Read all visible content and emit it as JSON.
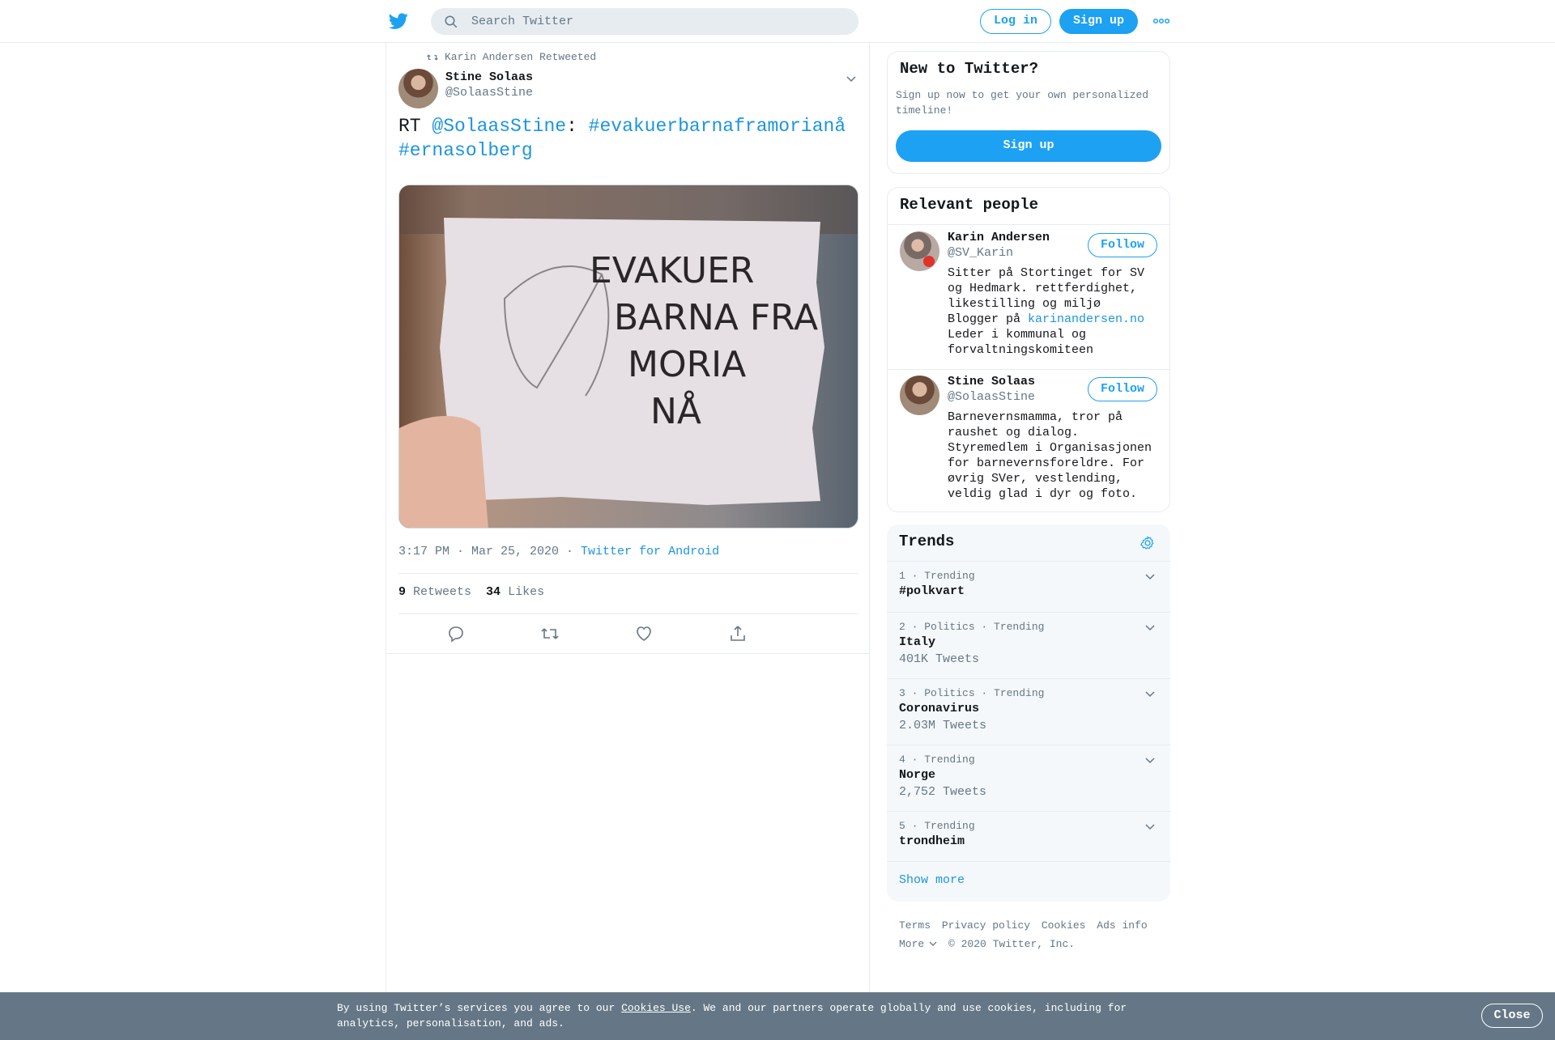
{
  "header": {
    "search_placeholder": "Search Twitter",
    "login_label": "Log in",
    "signup_label": "Sign up"
  },
  "tweet": {
    "retweet_context": "Karin Andersen Retweeted",
    "author_name": "Stine Solaas",
    "author_handle": "@SolaasStine",
    "text_prefix": "RT ",
    "mention": "@SolaasStine",
    "colon": ": ",
    "hashtag1": "#evakuerbarnaframorianå",
    "hashtag2": "#ernasolberg",
    "media_text": [
      "EVAKUER",
      "BARNA FRA",
      "MORIA",
      "NÅ"
    ],
    "time": "3:17 PM · Mar 25, 2020 · ",
    "source": "Twitter for Android",
    "retweets_count": "9",
    "retweets_label": "Retweets",
    "likes_count": "34",
    "likes_label": "Likes"
  },
  "new_to_twitter": {
    "title": "New to Twitter?",
    "description": "Sign up now to get your own personalized timeline!",
    "signup_label": "Sign up"
  },
  "relevant_people": {
    "title": "Relevant people",
    "people": [
      {
        "name": "Karin Andersen",
        "handle": "@SV_Karin",
        "follow_label": "Follow",
        "bio_lines": [
          "Sitter på Stortinget for SV",
          "og Hedmark. rettferdighet,",
          "likestilling og miljø"
        ],
        "bio_link_prefix": "Blogger på ",
        "bio_link": "karinandersen.no",
        "bio_lines2": [
          "Leder i kommunal og",
          "forvaltningskomiteen"
        ]
      },
      {
        "name": "Stine Solaas",
        "handle": "@SolaasStine",
        "follow_label": "Follow",
        "bio_lines": [
          "Barnevernsmamma, tror på",
          "raushet og dialog.",
          "Styremedlem i Organisasjonen",
          "for barnevernsforeldre. For",
          "øvrig SVer, vestlending,",
          "veldig glad i dyr og foto."
        ]
      }
    ]
  },
  "trends": {
    "title": "Trends",
    "items": [
      {
        "meta": "1 · Trending",
        "name": "#polkvart",
        "count": ""
      },
      {
        "meta": "2 · Politics · Trending",
        "name": "Italy",
        "count": "401K Tweets"
      },
      {
        "meta": "3 · Politics · Trending",
        "name": "Coronavirus",
        "count": "2.03M Tweets"
      },
      {
        "meta": "4 · Trending",
        "name": "Norge",
        "count": "2,752 Tweets"
      },
      {
        "meta": "5 · Trending",
        "name": "trondheim",
        "count": ""
      }
    ],
    "show_more": "Show more"
  },
  "footer": {
    "terms": "Terms",
    "privacy": "Privacy policy",
    "cookies": "Cookies",
    "ads_info": "Ads info",
    "more": "More",
    "copyright": "© 2020 Twitter, Inc."
  },
  "cookie_banner": {
    "text_before": "By using Twitter’s services you agree to our ",
    "link": "Cookies Use",
    "text_after": ". We and our partners operate globally and use cookies, including for analytics, personalisation, and ads.",
    "close_label": "Close"
  },
  "colors": {
    "brand": "#1da1f2",
    "link": "#1b95e0",
    "secondary_text": "#657786",
    "banner": "#657786"
  }
}
